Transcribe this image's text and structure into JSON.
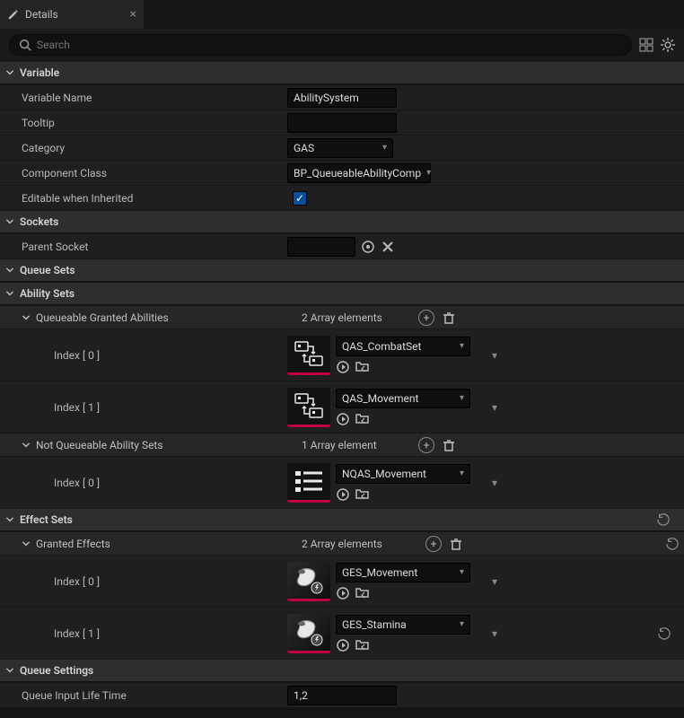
{
  "tab": {
    "title": "Details"
  },
  "search": {
    "placeholder": "Search"
  },
  "sections": {
    "variable": "Variable",
    "sockets": "Sockets",
    "queue_sets": "Queue Sets",
    "ability_sets": "Ability Sets",
    "effect_sets": "Effect Sets",
    "queue_settings": "Queue Settings"
  },
  "variable": {
    "name_label": "Variable Name",
    "name_value": "AbilitySystem",
    "tooltip_label": "Tooltip",
    "tooltip_value": "",
    "category_label": "Category",
    "category_value": "GAS",
    "component_class_label": "Component Class",
    "component_class_value": "BP_QueueableAbilityComp",
    "editable_label": "Editable when Inherited",
    "editable_checked": true
  },
  "sockets": {
    "parent_label": "Parent Socket",
    "parent_value": ""
  },
  "ability_sets": {
    "queueable": {
      "label": "Queueable Granted Abilities",
      "summary": "2 Array elements",
      "items": [
        {
          "index_label": "Index [ 0 ]",
          "asset": "QAS_CombatSet"
        },
        {
          "index_label": "Index [ 1 ]",
          "asset": "QAS_Movement"
        }
      ]
    },
    "notqueueable": {
      "label": "Not Queueable Ability Sets",
      "summary": "1 Array element",
      "items": [
        {
          "index_label": "Index [ 0 ]",
          "asset": "NQAS_Movement"
        }
      ]
    }
  },
  "effect_sets": {
    "granted": {
      "label": "Granted Effects",
      "summary": "2 Array elements",
      "items": [
        {
          "index_label": "Index [ 0 ]",
          "asset": "GES_Movement"
        },
        {
          "index_label": "Index [ 1 ]",
          "asset": "GES_Stamina"
        }
      ]
    }
  },
  "queue_settings": {
    "lifetime_label": "Queue Input Life Time",
    "lifetime_value": "1,2"
  }
}
